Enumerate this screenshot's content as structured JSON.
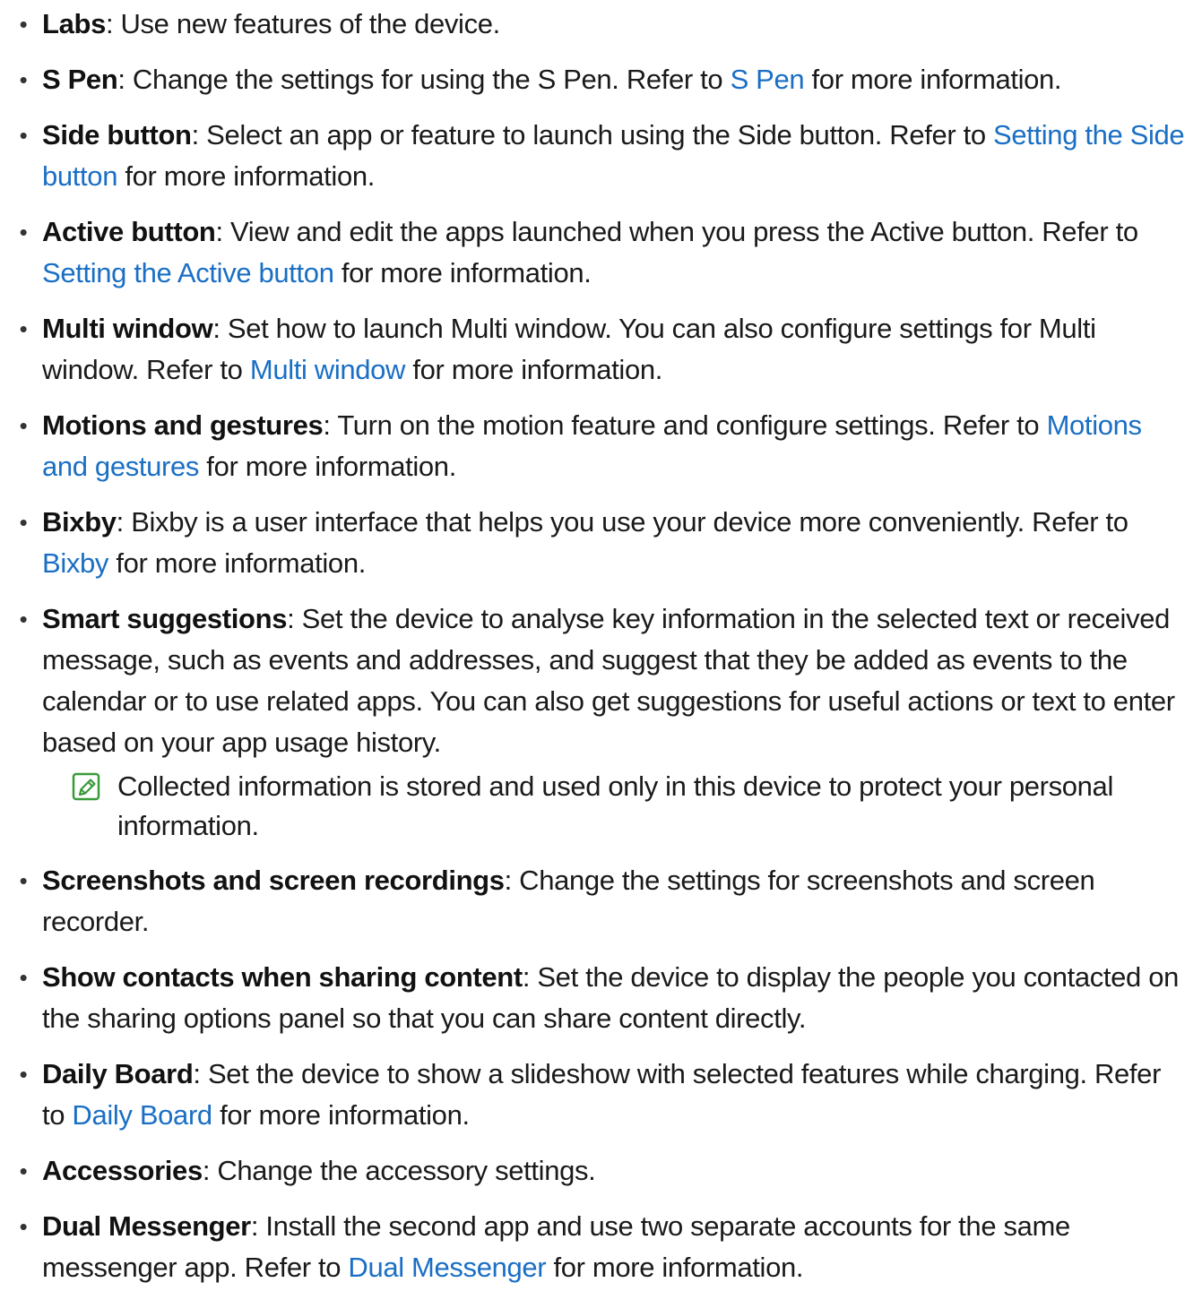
{
  "items": [
    {
      "term": "Labs",
      "pre": ": Use new features of the device.",
      "link": "",
      "post": ""
    },
    {
      "term": "S Pen",
      "pre": ": Change the settings for using the S Pen. Refer to ",
      "link": "S Pen",
      "post": " for more information."
    },
    {
      "term": "Side button",
      "pre": ": Select an app or feature to launch using the Side button. Refer to ",
      "link": "Setting the Side button",
      "post": " for more information."
    },
    {
      "term": "Active button",
      "pre": ": View and edit the apps launched when you press the Active button. Refer to ",
      "link": "Setting the Active button",
      "post": " for more information."
    },
    {
      "term": "Multi window",
      "pre": ": Set how to launch Multi window. You can also configure settings for Multi window. Refer to ",
      "link": "Multi window",
      "post": " for more information."
    },
    {
      "term": "Motions and gestures",
      "pre": ": Turn on the motion feature and configure settings. Refer to ",
      "link": "Motions and gestures",
      "post": " for more information."
    },
    {
      "term": "Bixby",
      "pre": ": Bixby is a user interface that helps you use your device more conveniently. Refer to ",
      "link": "Bixby",
      "post": " for more information."
    },
    {
      "term": "Smart suggestions",
      "pre": ": Set the device to analyse key information in the selected text or received message, such as events and addresses, and suggest that they be added as events to the calendar or to use related apps. You can also get suggestions for useful actions or text to enter based on your app usage history.",
      "link": "",
      "post": ""
    },
    {
      "term": "Screenshots and screen recordings",
      "pre": ": Change the settings for screenshots and screen recorder.",
      "link": "",
      "post": ""
    },
    {
      "term": "Show contacts when sharing content",
      "pre": ": Set the device to display the people you contacted on the sharing options panel so that you can share content directly.",
      "link": "",
      "post": ""
    },
    {
      "term": "Daily Board",
      "pre": ": Set the device to show a slideshow with selected features while charging. Refer to ",
      "link": "Daily Board",
      "post": " for more information."
    },
    {
      "term": "Accessories",
      "pre": ": Change the accessory settings.",
      "link": "",
      "post": ""
    },
    {
      "term": "Dual Messenger",
      "pre": ": Install the second app and use two separate accounts for the same messenger app. Refer to ",
      "link": "Dual Messenger",
      "post": " for more information."
    }
  ],
  "note": {
    "text": "Collected information is stored and used only in this device to protect your personal information.",
    "icon": "note-pencil-icon",
    "icon_color": "#3a9a3a"
  },
  "colors": {
    "link": "#1a6fc4",
    "text": "#1a1a1a"
  }
}
